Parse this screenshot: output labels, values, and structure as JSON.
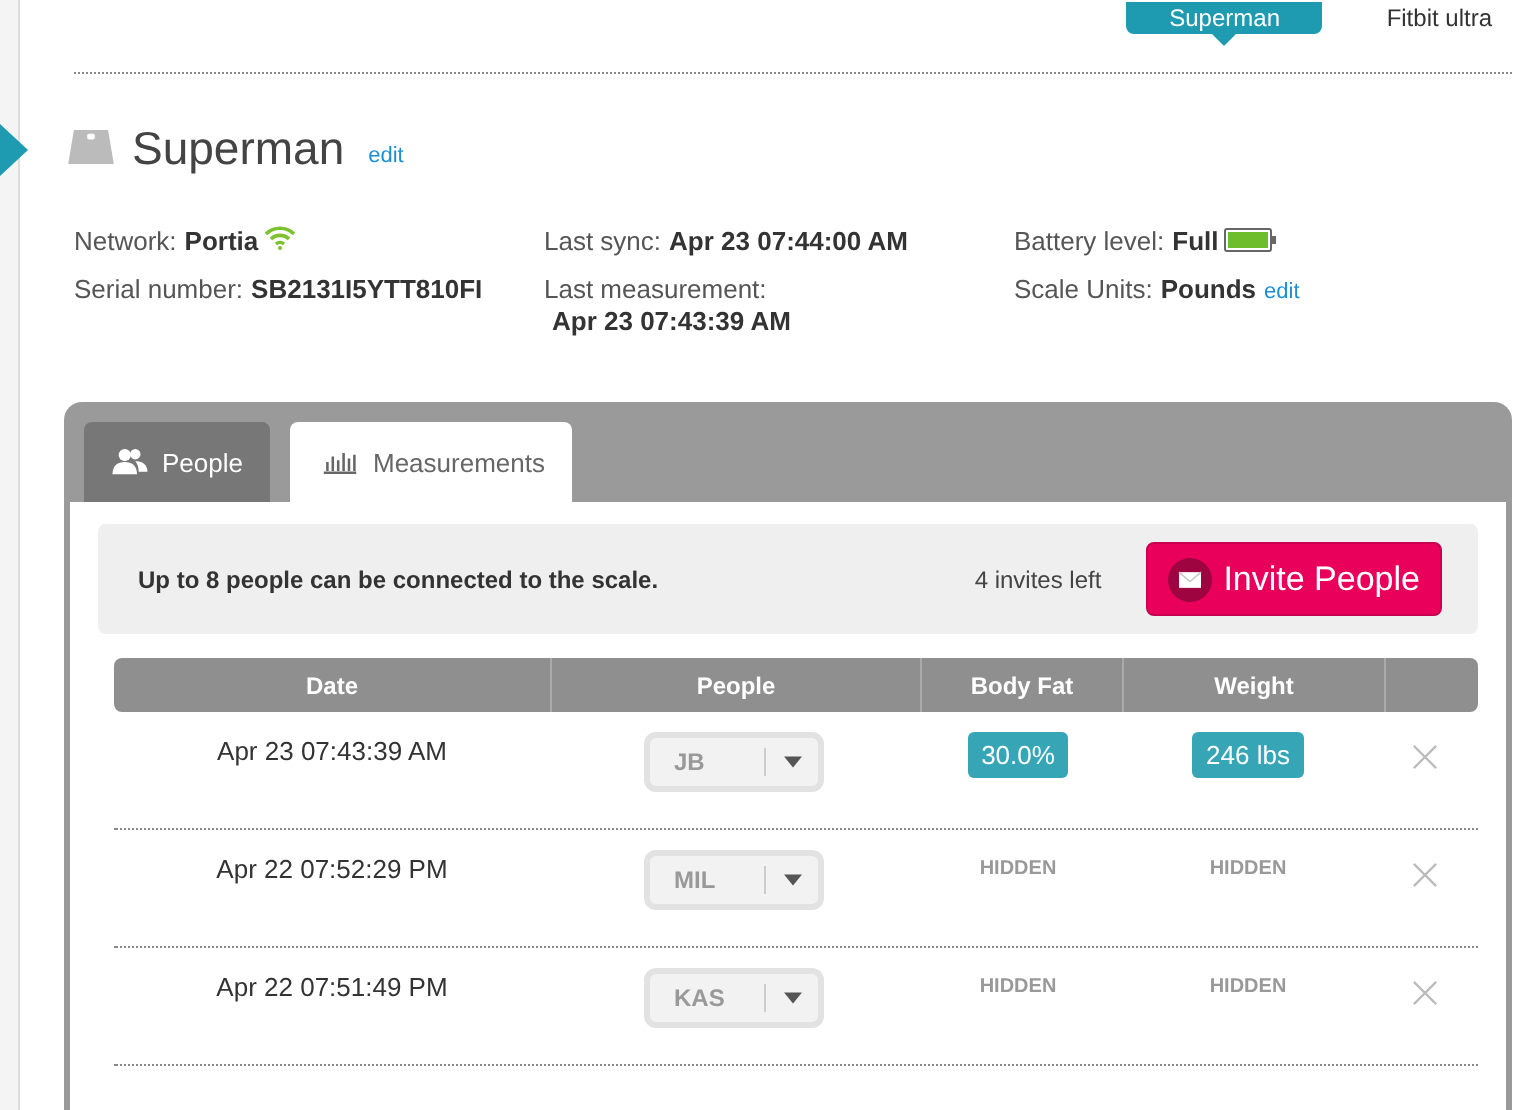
{
  "device_tabs": [
    {
      "label": "Superman",
      "selected": true
    },
    {
      "label": "Fitbit ultra",
      "selected": false
    }
  ],
  "device": {
    "name": "Superman",
    "edit": "edit"
  },
  "info": [
    {
      "label": "Network:",
      "value": "Portia",
      "kind": "wifi"
    },
    {
      "label": "Last sync:",
      "value": "Apr 23 07:44:00 AM",
      "kind": "plain"
    },
    {
      "label": "Battery level:",
      "value": "Full",
      "kind": "battery"
    },
    {
      "label": "Serial number:",
      "value": "SB2131I5YTT810FI",
      "kind": "plain"
    },
    {
      "label": "Last measurement:",
      "value": "Apr 23 07:43:39 AM",
      "kind": "stacked"
    },
    {
      "label": "Scale Units:",
      "value": "Pounds",
      "kind": "edit",
      "edit": "edit"
    }
  ],
  "tabs": [
    {
      "label": "People",
      "selected": false,
      "kind": "people"
    },
    {
      "label": "Measurements",
      "selected": true,
      "kind": "chart"
    }
  ],
  "invite_bar": {
    "message": "Up to 8 people can be connected to the scale.",
    "invites_left": "4 invites left",
    "button": "Invite People"
  },
  "table": {
    "columns": [
      "Date",
      "People",
      "Body Fat",
      "Weight"
    ],
    "rows": [
      {
        "date": "Apr 23 07:43:39 AM",
        "person": "JB",
        "body_fat": {
          "value": "30.0%",
          "shown": true
        },
        "weight": {
          "value": "246 lbs",
          "shown": true
        }
      },
      {
        "date": "Apr 22 07:52:29 PM",
        "person": "MIL",
        "body_fat": {
          "value": "HIDDEN",
          "shown": false
        },
        "weight": {
          "value": "HIDDEN",
          "shown": false
        }
      },
      {
        "date": "Apr 22 07:51:49 PM",
        "person": "KAS",
        "body_fat": {
          "value": "HIDDEN",
          "shown": false
        },
        "weight": {
          "value": "HIDDEN",
          "shown": false
        }
      }
    ]
  }
}
